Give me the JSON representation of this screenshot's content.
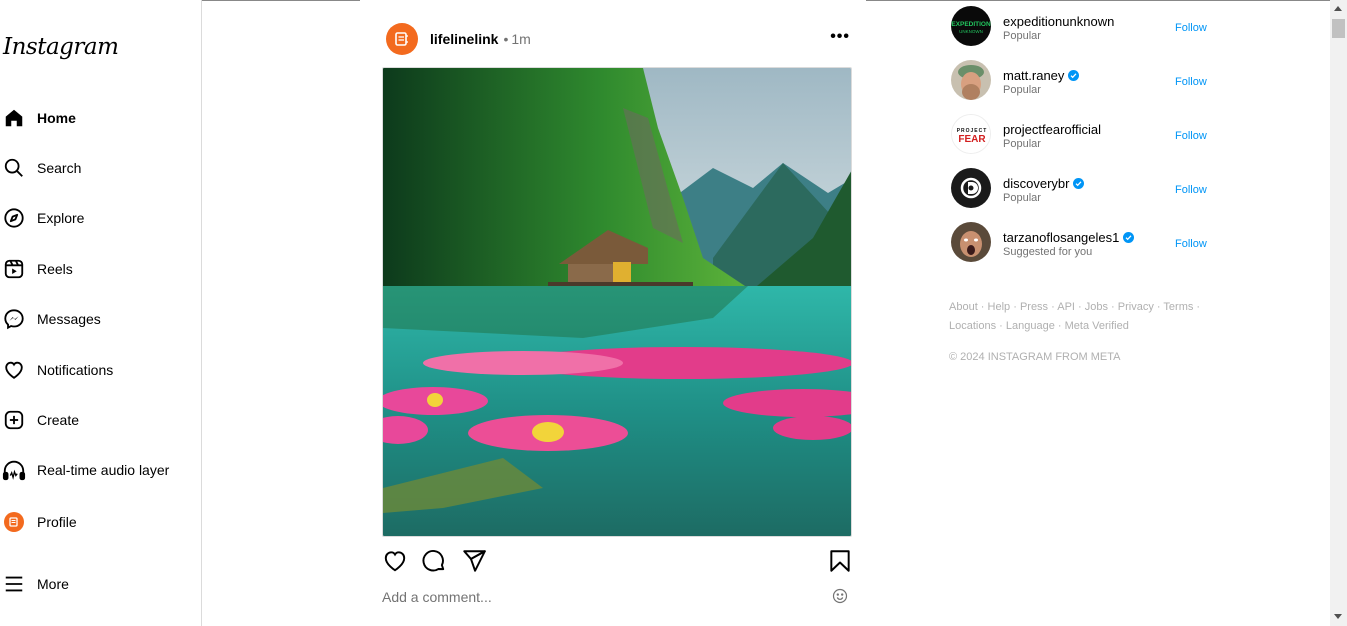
{
  "app": {
    "logo": "Instagram"
  },
  "nav": {
    "items": [
      {
        "label": "Home",
        "icon": "home-icon"
      },
      {
        "label": "Search",
        "icon": "search-icon"
      },
      {
        "label": "Explore",
        "icon": "compass-icon"
      },
      {
        "label": "Reels",
        "icon": "reels-icon"
      },
      {
        "label": "Messages",
        "icon": "messenger-icon"
      },
      {
        "label": "Notifications",
        "icon": "heart-icon"
      },
      {
        "label": "Create",
        "icon": "plus-square-icon"
      },
      {
        "label": "Real-time audio layer",
        "icon": "headphones-icon"
      },
      {
        "label": "Profile",
        "icon": "avatar"
      },
      {
        "label": "More",
        "icon": "menu-icon"
      }
    ]
  },
  "post": {
    "username": "lifelinelink",
    "separator": "•",
    "time": "1m",
    "more": "•••",
    "comment_placeholder": "Add a comment..."
  },
  "suggestions": [
    {
      "name": "expeditionunknown",
      "subtitle": "Popular",
      "verified": false,
      "follow": "Follow"
    },
    {
      "name": "matt.raney",
      "subtitle": "Popular",
      "verified": true,
      "follow": "Follow"
    },
    {
      "name": "projectfearofficial",
      "subtitle": "Popular",
      "verified": false,
      "follow": "Follow"
    },
    {
      "name": "discoverybr",
      "subtitle": "Popular",
      "verified": true,
      "follow": "Follow"
    },
    {
      "name": "tarzanoflosangeles1",
      "subtitle": "Suggested for you",
      "verified": true,
      "follow": "Follow"
    }
  ],
  "avatar_text": {
    "expedition_line1": "EXPEDITION",
    "expedition_line2": "UNKNOWN",
    "project_line": "PROJECT",
    "fear_line": "FEAR"
  },
  "footer": {
    "links": [
      "About",
      "Help",
      "Press",
      "API",
      "Jobs",
      "Privacy",
      "Terms",
      "Locations",
      "Language",
      "Meta Verified"
    ],
    "separator": " · ",
    "copyright": "© 2024 INSTAGRAM FROM META"
  },
  "colors": {
    "accent": "#0095f6",
    "brand_orange": "#f36a1e",
    "muted": "#737373"
  }
}
